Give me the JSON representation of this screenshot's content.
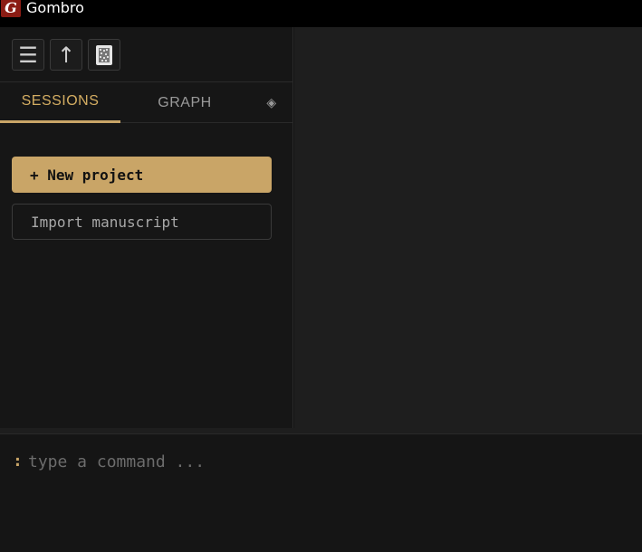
{
  "window": {
    "title": "Gombro",
    "logo_letter": "G"
  },
  "toolbar": {
    "buttons": [
      {
        "icon": "hamburger-menu-icon",
        "glyph": "☰"
      },
      {
        "icon": "up-arrow-icon",
        "glyph": "↑"
      },
      {
        "icon": "notebook-icon"
      }
    ]
  },
  "tabs": [
    {
      "label": "SESSIONS",
      "active": true
    },
    {
      "label": "GRAPH",
      "active": false
    },
    {
      "label": "◈",
      "icon": "diamond-icon",
      "active": false
    }
  ],
  "sidebar": {
    "new_project_label": "+ New project",
    "import_label": "Import manuscript"
  },
  "command": {
    "prompt": ":",
    "placeholder": "type a command ..."
  },
  "colors": {
    "accent": "#c9a567",
    "logo": "#8b1c14",
    "background": "#151515",
    "main_panel": "#1e1e1e"
  }
}
